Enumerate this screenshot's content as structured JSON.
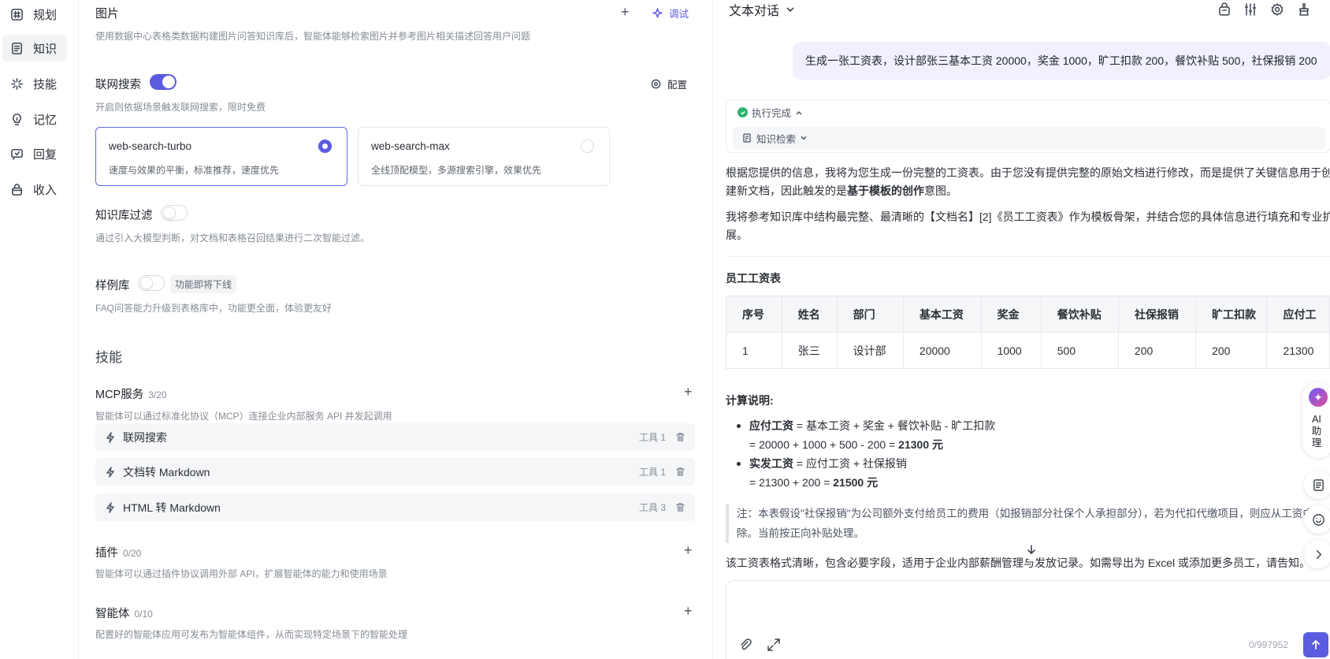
{
  "nav": {
    "items": [
      {
        "label": "规划",
        "icon": "hash-icon"
      },
      {
        "label": "知识",
        "icon": "document-icon",
        "active": true
      },
      {
        "label": "技能",
        "icon": "sparkle-icon"
      },
      {
        "label": "记忆",
        "icon": "bulb-icon"
      },
      {
        "label": "回复",
        "icon": "reply-icon"
      },
      {
        "label": "收入",
        "icon": "bag-icon"
      }
    ]
  },
  "knowledge": {
    "image": {
      "title": "图片",
      "desc": "使用数据中心表格类数据构建图片问答知识库后，智能体能够检索图片并参考图片相关描述回答用户问题",
      "debug_label": "调试"
    },
    "web_search": {
      "title": "联网搜索",
      "enabled": true,
      "config_label": "配置",
      "desc": "开启则依据场景触发联网搜索，限时免费",
      "models": [
        {
          "name": "web-search-turbo",
          "desc": "速度与效果的平衡，标准推荐，速度优先",
          "selected": true
        },
        {
          "name": "web-search-max",
          "desc": "全线顶配模型，多源搜索引擎，效果优先",
          "selected": false
        }
      ]
    },
    "kb_filter": {
      "title": "知识库过滤",
      "enabled": false,
      "desc": "通过引入大模型判断，对文档和表格召回结果进行二次智能过滤。"
    },
    "examples": {
      "title": "样例库",
      "enabled": false,
      "tag": "功能即将下线",
      "desc": "FAQ问答能力升级到表格库中，功能更全面，体验更友好"
    }
  },
  "skills": {
    "title": "技能",
    "mcp": {
      "title": "MCP服务",
      "count": "3/20",
      "desc": "智能体可以通过标准化协议（MCP）连接企业内部服务 API 并发起调用",
      "tools": [
        {
          "name": "联网搜索",
          "count": "工具 1"
        },
        {
          "name": "文档转 Markdown",
          "count": "工具 1"
        },
        {
          "name": "HTML 转 Markdown",
          "count": "工具 3"
        }
      ]
    },
    "plugins": {
      "title": "插件",
      "count": "0/20",
      "desc": "智能体可以通过插件协议调用外部 API，扩展智能体的能力和使用场景"
    },
    "agents": {
      "title": "智能体",
      "count": "0/10",
      "desc": "配置好的智能体应用可发布为智能体组件，从而实现特定场景下的智能处理"
    }
  },
  "chat": {
    "mode": "文本对话",
    "user_message": "生成一张工资表，设计部张三基本工资 20000，奖金 1000，旷工扣款 200，餐饮补贴 500，社保报销 200",
    "status": "执行完成",
    "kb_search": "知识检索",
    "answer": {
      "p1_before": "根据您提供的信息，我将为您生成一份完整的工资表。由于您没有提供完整的原始文档进行修改，而是提供了关键信息用于创建新文档，因此触发的是",
      "p1_bold": "基于模板的创作",
      "p1_after": "意图。",
      "p2": "我将参考知识库中结构最完整、最清晰的【文档名】[2]《员工工资表》作为模板骨架，并结合您的具体信息进行填充和专业扩展。",
      "table_title": "员工工资表",
      "table": {
        "headers": [
          "序号",
          "姓名",
          "部门",
          "基本工资",
          "奖金",
          "餐饮补贴",
          "社保报销",
          "旷工扣款",
          "应付工"
        ],
        "rows": [
          [
            "1",
            "张三",
            "设计部",
            "20000",
            "1000",
            "500",
            "200",
            "200",
            "21300"
          ]
        ]
      },
      "calc_title": "计算说明:",
      "calc": [
        {
          "term": "应付工资",
          "formula": " = 基本工资 + 奖金 + 餐饮补贴 - 旷工扣款",
          "expr": "= 20000 + 1000 + 500 - 200 = ",
          "result": "21300 元"
        },
        {
          "term": "实发工资",
          "formula": " = 应付工资 + 社保报销",
          "expr": "= 21300 + 200 = ",
          "result": "21500 元"
        }
      ],
      "note": "注：本表假设\"社保报销\"为公司额外支付给员工的费用（如报销部分社保个人承担部分），若为代扣代缴项目，则应从工资中扣除。当前按正向补贴处理。",
      "closing": "该工资表格式清晰，包含必要字段，适用于企业内部薪酬管理与发放记录。如需导出为 Excel 或添加更多员工，请告知。"
    },
    "input": {
      "counter": "0/997952"
    },
    "assistant_label": "AI助理"
  }
}
